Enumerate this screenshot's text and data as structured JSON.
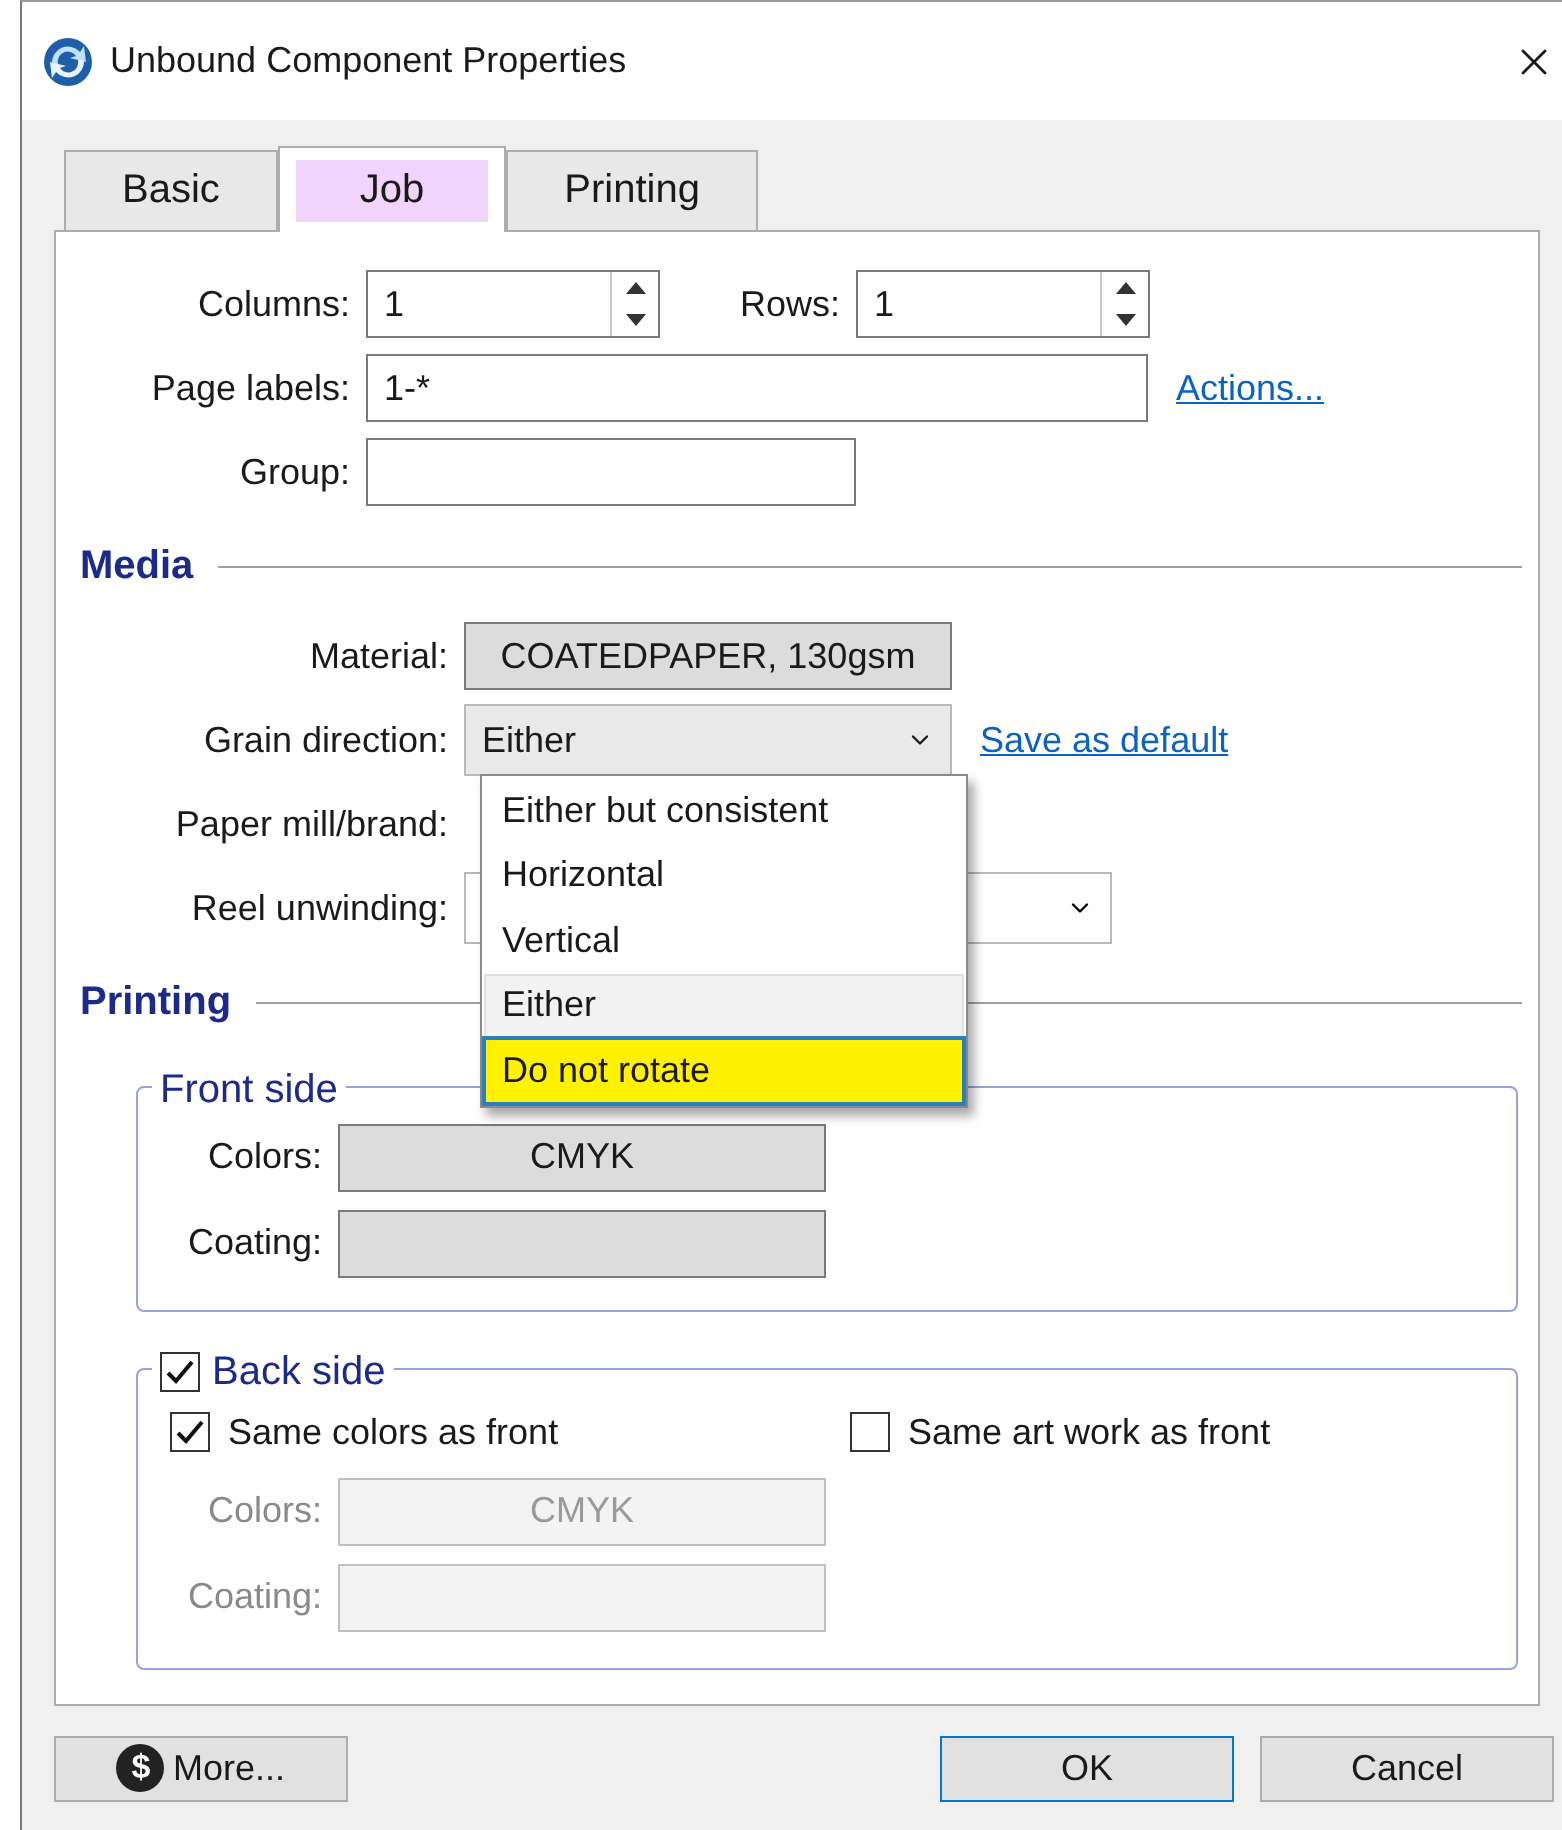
{
  "window": {
    "title": "Unbound Component Properties"
  },
  "tabs": [
    {
      "label": "Basic",
      "selected": false
    },
    {
      "label": "Job",
      "selected": true
    },
    {
      "label": "Printing",
      "selected": false
    }
  ],
  "job": {
    "columns": {
      "label": "Columns:",
      "value": "1"
    },
    "rows": {
      "label": "Rows:",
      "value": "1"
    },
    "page_labels": {
      "label": "Page labels:",
      "value": "1-*"
    },
    "actions_link": "Actions...",
    "group": {
      "label": "Group:"
    }
  },
  "media": {
    "heading": "Media",
    "material": {
      "label": "Material:",
      "value": "COATEDPAPER, 130gsm"
    },
    "grain_direction": {
      "label": "Grain direction:",
      "value": "Either",
      "link": "Save as default",
      "expanded": true
    },
    "paper_mill": {
      "label": "Paper mill/brand:"
    },
    "reel_unwinding": {
      "label": "Reel unwinding:"
    },
    "options": [
      {
        "label": "Either but consistent",
        "selected": false,
        "focused": false
      },
      {
        "label": "Horizontal",
        "selected": false,
        "focused": false
      },
      {
        "label": "Vertical",
        "selected": false,
        "focused": false
      },
      {
        "label": "Either",
        "selected": true,
        "focused": false
      },
      {
        "label": "Do not rotate",
        "selected": false,
        "focused": true
      }
    ]
  },
  "printing": {
    "heading": "Printing",
    "front_side": {
      "title": "Front side",
      "colors": {
        "label": "Colors:",
        "value": "CMYK"
      },
      "coating": {
        "label": "Coating:"
      }
    },
    "back_side": {
      "title": "Back side",
      "checked": true,
      "same_colors": {
        "label": "Same colors as front",
        "checked": true
      },
      "same_artwork": {
        "label": "Same art work as front",
        "checked": false
      },
      "colors": {
        "label": "Colors:",
        "value": "CMYK",
        "disabled": true
      },
      "coating": {
        "label": "Coating:",
        "disabled": true
      }
    }
  },
  "buttons": [
    {
      "label": "More...",
      "kind": "more",
      "icon": "$"
    },
    {
      "label": "OK",
      "kind": "default"
    },
    {
      "label": "Cancel",
      "kind": "plain"
    }
  ]
}
